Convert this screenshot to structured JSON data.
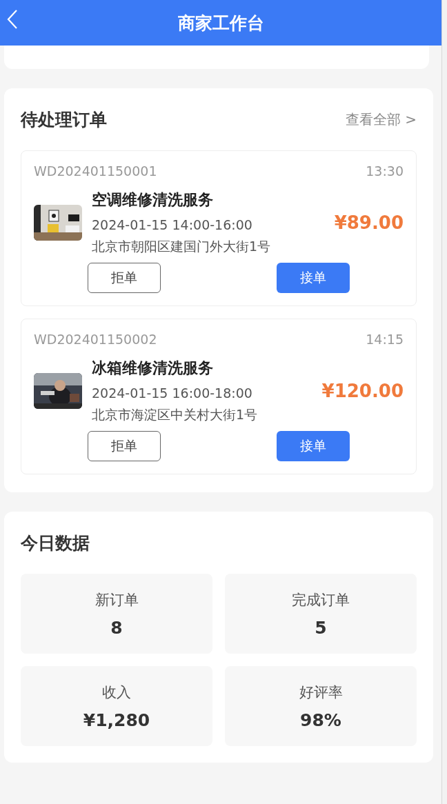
{
  "header": {
    "title": "商家工作台"
  },
  "pending": {
    "title": "待处理订单",
    "view_all": "查看全部 >",
    "orders": [
      {
        "order_no": "WD202401150001",
        "time": "13:30",
        "service": "空调维修清洗服务",
        "slot": "2024-01-15 14:00-16:00",
        "address": "北京市朝阳区建国门外大街1号",
        "price": "¥89.00",
        "reject": "拒单",
        "accept": "接单"
      },
      {
        "order_no": "WD202401150002",
        "time": "14:15",
        "service": "冰箱维修清洗服务",
        "slot": "2024-01-15 16:00-18:00",
        "address": "北京市海淀区中关村大街1号",
        "price": "¥120.00",
        "reject": "拒单",
        "accept": "接单"
      }
    ]
  },
  "today": {
    "title": "今日数据",
    "stats": [
      {
        "label": "新订单",
        "value": "8"
      },
      {
        "label": "完成订单",
        "value": "5"
      },
      {
        "label": "收入",
        "value": "¥1,280"
      },
      {
        "label": "好评率",
        "value": "98%"
      }
    ]
  }
}
